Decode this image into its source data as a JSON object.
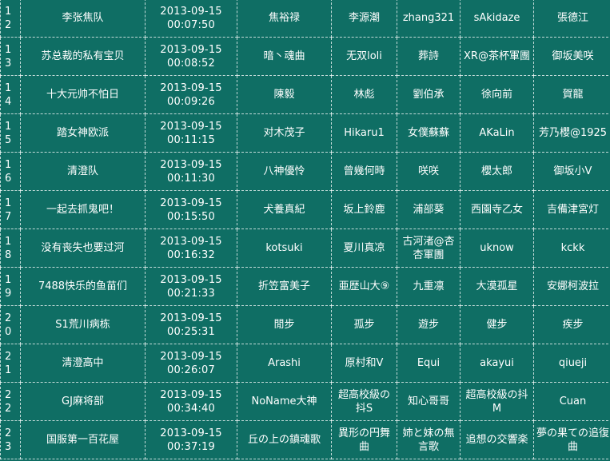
{
  "rows": [
    {
      "rank": "12",
      "team": "李张焦队",
      "date": "2013-09-15",
      "time": "00:07:50",
      "m1": "焦裕禄",
      "m2": "李源潮",
      "m3": "zhang321",
      "m4": "sAkidaze",
      "m5": "張德江"
    },
    {
      "rank": "13",
      "team": "苏总裁的私有宝贝",
      "date": "2013-09-15",
      "time": "00:08:52",
      "m1": "暗丶魂曲",
      "m2": "无双loli",
      "m3": "葬詩",
      "m4": "XR@茶杯軍團",
      "m5": "御坂美咲"
    },
    {
      "rank": "14",
      "team": "十大元帅不怕日",
      "date": "2013-09-15",
      "time": "00:09:26",
      "m1": "陳毅",
      "m2": "林彪",
      "m3": "劉伯承",
      "m4": "徐向前",
      "m5": "賀龍"
    },
    {
      "rank": "15",
      "team": "踏女神欧派",
      "date": "2013-09-15",
      "time": "00:11:15",
      "m1": "对木茂子",
      "m2": "Hikaru1",
      "m3": "女僕蘇蘇",
      "m4": "AKaLin",
      "m5": "芳乃櫻@1925"
    },
    {
      "rank": "16",
      "team": "清澄队",
      "date": "2013-09-15",
      "time": "00:11:30",
      "m1": "八神優怜",
      "m2": "曾幾何時",
      "m3": "咲咲",
      "m4": "櫻太郎",
      "m5": "御坂小V"
    },
    {
      "rank": "17",
      "team": "一起去抓鬼吧！",
      "date": "2013-09-15",
      "time": "00:15:50",
      "m1": "犬養真紀",
      "m2": "坂上鈴鹿",
      "m3": "浦部葵",
      "m4": "西園寺乙女",
      "m5": "吉備津宮灯"
    },
    {
      "rank": "18",
      "team": "没有丧失也要过河",
      "date": "2013-09-15",
      "time": "00:16:32",
      "m1": "kotsuki",
      "m2": "夏川真凉",
      "m3": "古河渚@杏杏軍團",
      "m4": "uknow",
      "m5": "kckk"
    },
    {
      "rank": "19",
      "team": "7488快乐的鱼苗们",
      "date": "2013-09-15",
      "time": "00:21:33",
      "m1": "折笠富美子",
      "m2": "亜歴山大⑨",
      "m3": "九重凛",
      "m4": "大漠孤星",
      "m5": "安娜柯波拉"
    },
    {
      "rank": "20",
      "team": "S1荒川病栋",
      "date": "2013-09-15",
      "time": "00:25:31",
      "m1": "閒步",
      "m2": "孤步",
      "m3": "遊步",
      "m4": "健步",
      "m5": "疾步"
    },
    {
      "rank": "21",
      "team": "清澄高中",
      "date": "2013-09-15",
      "time": "00:26:07",
      "m1": "Arashi",
      "m2": "原村和V",
      "m3": "Equi",
      "m4": "akayui",
      "m5": "qiueji"
    },
    {
      "rank": "22",
      "team": "GJ麻将部",
      "date": "2013-09-15",
      "time": "00:34:40",
      "m1": "NoName大神",
      "m2": "超高校級の抖S",
      "m3": "知心哥哥",
      "m4": "超高校級の抖M",
      "m5": "Cuan"
    },
    {
      "rank": "23",
      "team": "国服第一百花屋",
      "date": "2013-09-15",
      "time": "00:37:19",
      "m1": "丘の上の鎮魂歌",
      "m2": "異形の円舞曲",
      "m3": "姉と妹の無言歌",
      "m4": "追想の交響楽",
      "m5": "夢の果ての追復曲"
    }
  ],
  "colors": {
    "background": "#0f6e64",
    "text": "#ffffff",
    "border": "#ffffff"
  }
}
